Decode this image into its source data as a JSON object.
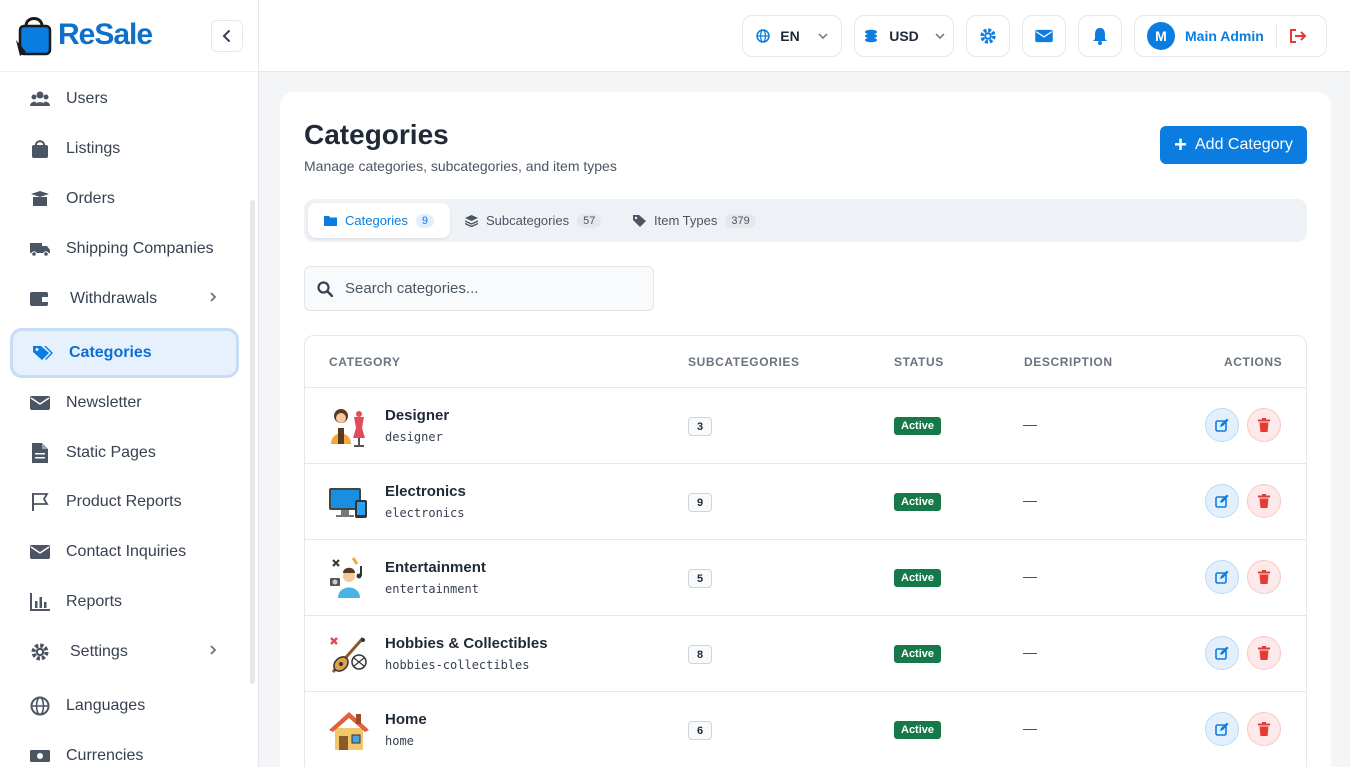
{
  "app": {
    "logo_text": "ReSale"
  },
  "sidebar": {
    "items": [
      {
        "label": "Users",
        "icon": "users-icon"
      },
      {
        "label": "Listings",
        "icon": "shopping-bag-icon"
      },
      {
        "label": "Orders",
        "icon": "box-open-icon"
      },
      {
        "label": "Shipping Companies",
        "icon": "truck-icon"
      },
      {
        "label": "Withdrawals",
        "icon": "wallet-icon"
      },
      {
        "label": "Categories",
        "icon": "tags-icon"
      },
      {
        "label": "Newsletter",
        "icon": "envelope-icon"
      },
      {
        "label": "Static Pages",
        "icon": "file-icon"
      },
      {
        "label": "Product Reports",
        "icon": "flag-icon"
      },
      {
        "label": "Contact Inquiries",
        "icon": "envelope-icon"
      },
      {
        "label": "Reports",
        "icon": "bar-chart-icon"
      },
      {
        "label": "Settings",
        "icon": "gear-icon"
      },
      {
        "label": "Languages",
        "icon": "globe-icon"
      },
      {
        "label": "Currencies",
        "icon": "money-icon"
      }
    ],
    "active": "Categories"
  },
  "topbar": {
    "language": "EN",
    "currency": "USD",
    "user_initial": "M",
    "user_name": "Main Admin"
  },
  "page": {
    "title": "Categories",
    "subtitle": "Manage categories, subcategories, and item types",
    "add_button": "Add Category",
    "tabs": [
      {
        "label": "Categories",
        "count": "9"
      },
      {
        "label": "Subcategories",
        "count": "57"
      },
      {
        "label": "Item Types",
        "count": "379"
      }
    ],
    "search_placeholder": "Search categories..."
  },
  "table": {
    "headers": [
      "CATEGORY",
      "SUBCATEGORIES",
      "STATUS",
      "DESCRIPTION",
      "ACTIONS"
    ],
    "rows": [
      {
        "name": "Designer",
        "slug": "designer",
        "subcategories": "3",
        "status": "Active",
        "description": "—"
      },
      {
        "name": "Electronics",
        "slug": "electronics",
        "subcategories": "9",
        "status": "Active",
        "description": "—"
      },
      {
        "name": "Entertainment",
        "slug": "entertainment",
        "subcategories": "5",
        "status": "Active",
        "description": "—"
      },
      {
        "name": "Hobbies & Collectibles",
        "slug": "hobbies-collectibles",
        "subcategories": "8",
        "status": "Active",
        "description": "—"
      },
      {
        "name": "Home",
        "slug": "home",
        "subcategories": "6",
        "status": "Active",
        "description": "—"
      }
    ]
  },
  "colors": {
    "primary": "#0c7de0",
    "active_badge": "#16794a",
    "delete": "#e53935"
  }
}
